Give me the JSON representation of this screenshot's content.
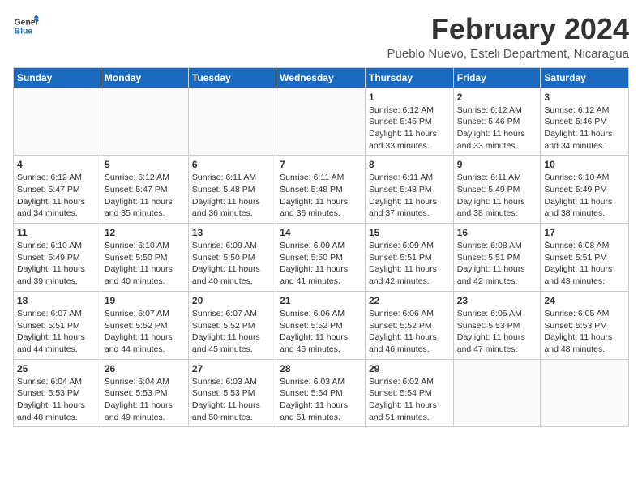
{
  "header": {
    "logo_general": "General",
    "logo_blue": "Blue",
    "main_title": "February 2024",
    "subtitle": "Pueblo Nuevo, Esteli Department, Nicaragua"
  },
  "calendar": {
    "days_of_week": [
      "Sunday",
      "Monday",
      "Tuesday",
      "Wednesday",
      "Thursday",
      "Friday",
      "Saturday"
    ],
    "weeks": [
      [
        {
          "day": "",
          "detail": ""
        },
        {
          "day": "",
          "detail": ""
        },
        {
          "day": "",
          "detail": ""
        },
        {
          "day": "",
          "detail": ""
        },
        {
          "day": "1",
          "detail": "Sunrise: 6:12 AM\nSunset: 5:45 PM\nDaylight: 11 hours and 33 minutes."
        },
        {
          "day": "2",
          "detail": "Sunrise: 6:12 AM\nSunset: 5:46 PM\nDaylight: 11 hours and 33 minutes."
        },
        {
          "day": "3",
          "detail": "Sunrise: 6:12 AM\nSunset: 5:46 PM\nDaylight: 11 hours and 34 minutes."
        }
      ],
      [
        {
          "day": "4",
          "detail": "Sunrise: 6:12 AM\nSunset: 5:47 PM\nDaylight: 11 hours and 34 minutes."
        },
        {
          "day": "5",
          "detail": "Sunrise: 6:12 AM\nSunset: 5:47 PM\nDaylight: 11 hours and 35 minutes."
        },
        {
          "day": "6",
          "detail": "Sunrise: 6:11 AM\nSunset: 5:48 PM\nDaylight: 11 hours and 36 minutes."
        },
        {
          "day": "7",
          "detail": "Sunrise: 6:11 AM\nSunset: 5:48 PM\nDaylight: 11 hours and 36 minutes."
        },
        {
          "day": "8",
          "detail": "Sunrise: 6:11 AM\nSunset: 5:48 PM\nDaylight: 11 hours and 37 minutes."
        },
        {
          "day": "9",
          "detail": "Sunrise: 6:11 AM\nSunset: 5:49 PM\nDaylight: 11 hours and 38 minutes."
        },
        {
          "day": "10",
          "detail": "Sunrise: 6:10 AM\nSunset: 5:49 PM\nDaylight: 11 hours and 38 minutes."
        }
      ],
      [
        {
          "day": "11",
          "detail": "Sunrise: 6:10 AM\nSunset: 5:49 PM\nDaylight: 11 hours and 39 minutes."
        },
        {
          "day": "12",
          "detail": "Sunrise: 6:10 AM\nSunset: 5:50 PM\nDaylight: 11 hours and 40 minutes."
        },
        {
          "day": "13",
          "detail": "Sunrise: 6:09 AM\nSunset: 5:50 PM\nDaylight: 11 hours and 40 minutes."
        },
        {
          "day": "14",
          "detail": "Sunrise: 6:09 AM\nSunset: 5:50 PM\nDaylight: 11 hours and 41 minutes."
        },
        {
          "day": "15",
          "detail": "Sunrise: 6:09 AM\nSunset: 5:51 PM\nDaylight: 11 hours and 42 minutes."
        },
        {
          "day": "16",
          "detail": "Sunrise: 6:08 AM\nSunset: 5:51 PM\nDaylight: 11 hours and 42 minutes."
        },
        {
          "day": "17",
          "detail": "Sunrise: 6:08 AM\nSunset: 5:51 PM\nDaylight: 11 hours and 43 minutes."
        }
      ],
      [
        {
          "day": "18",
          "detail": "Sunrise: 6:07 AM\nSunset: 5:51 PM\nDaylight: 11 hours and 44 minutes."
        },
        {
          "day": "19",
          "detail": "Sunrise: 6:07 AM\nSunset: 5:52 PM\nDaylight: 11 hours and 44 minutes."
        },
        {
          "day": "20",
          "detail": "Sunrise: 6:07 AM\nSunset: 5:52 PM\nDaylight: 11 hours and 45 minutes."
        },
        {
          "day": "21",
          "detail": "Sunrise: 6:06 AM\nSunset: 5:52 PM\nDaylight: 11 hours and 46 minutes."
        },
        {
          "day": "22",
          "detail": "Sunrise: 6:06 AM\nSunset: 5:52 PM\nDaylight: 11 hours and 46 minutes."
        },
        {
          "day": "23",
          "detail": "Sunrise: 6:05 AM\nSunset: 5:53 PM\nDaylight: 11 hours and 47 minutes."
        },
        {
          "day": "24",
          "detail": "Sunrise: 6:05 AM\nSunset: 5:53 PM\nDaylight: 11 hours and 48 minutes."
        }
      ],
      [
        {
          "day": "25",
          "detail": "Sunrise: 6:04 AM\nSunset: 5:53 PM\nDaylight: 11 hours and 48 minutes."
        },
        {
          "day": "26",
          "detail": "Sunrise: 6:04 AM\nSunset: 5:53 PM\nDaylight: 11 hours and 49 minutes."
        },
        {
          "day": "27",
          "detail": "Sunrise: 6:03 AM\nSunset: 5:53 PM\nDaylight: 11 hours and 50 minutes."
        },
        {
          "day": "28",
          "detail": "Sunrise: 6:03 AM\nSunset: 5:54 PM\nDaylight: 11 hours and 51 minutes."
        },
        {
          "day": "29",
          "detail": "Sunrise: 6:02 AM\nSunset: 5:54 PM\nDaylight: 11 hours and 51 minutes."
        },
        {
          "day": "",
          "detail": ""
        },
        {
          "day": "",
          "detail": ""
        }
      ]
    ]
  }
}
